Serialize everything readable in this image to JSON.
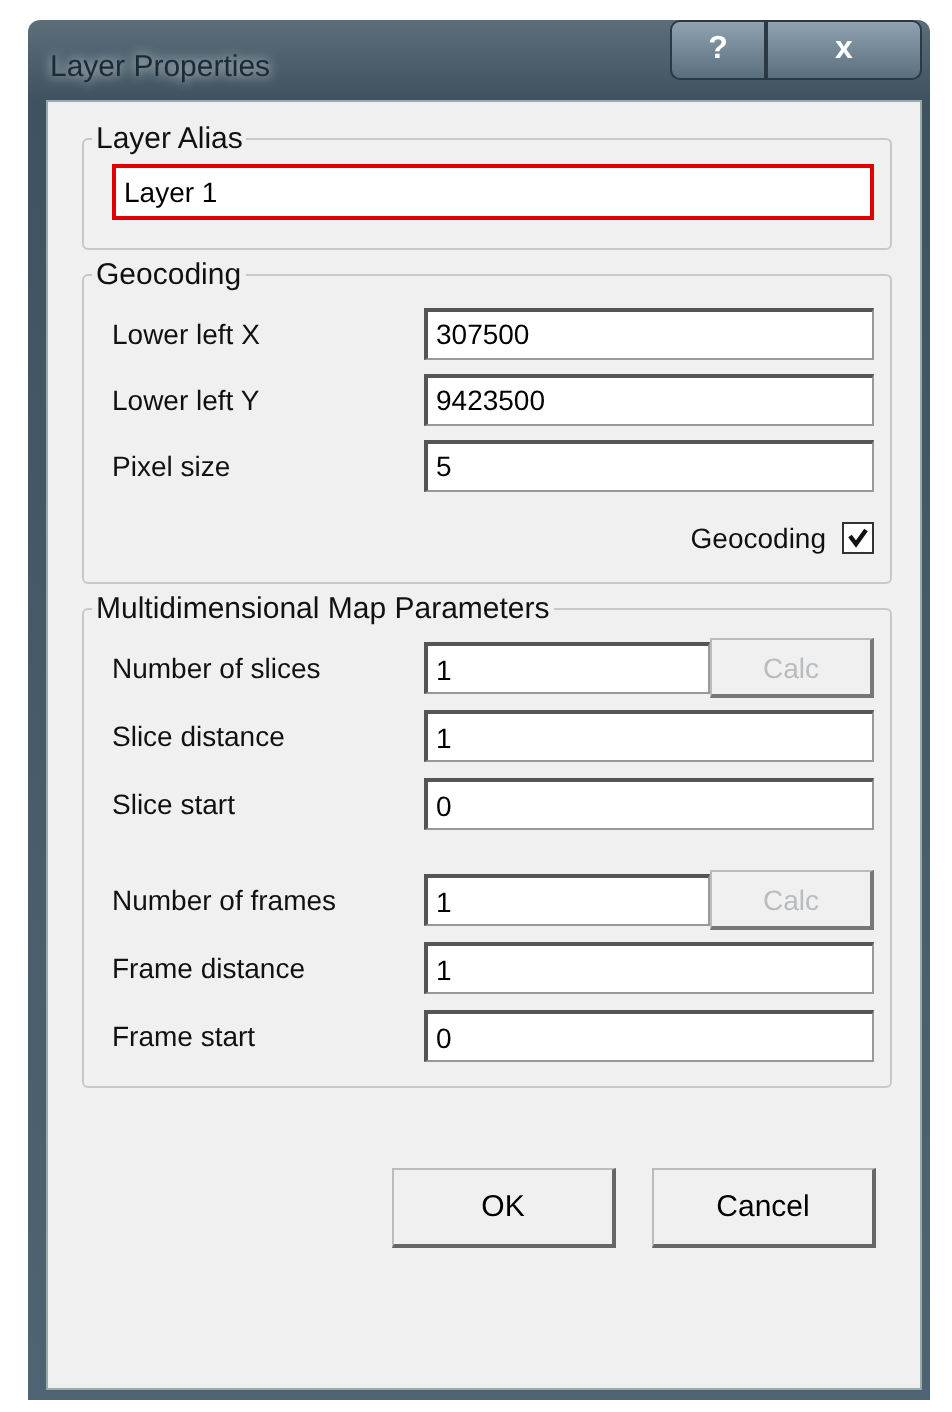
{
  "window": {
    "title": "Layer Properties",
    "title_buttons": [
      "?",
      "x"
    ]
  },
  "alias_group": {
    "title": "Layer Alias",
    "value": "Layer 1",
    "highlighted": true
  },
  "geocoding_group": {
    "title": "Geocoding",
    "rows": [
      {
        "label": "Lower left X",
        "value": "307500"
      },
      {
        "label": "Lower left Y",
        "value": "9423500"
      },
      {
        "label": "Pixel size",
        "value": "5"
      }
    ],
    "checkbox": {
      "label": "Geocoding",
      "checked": true
    }
  },
  "multi_group": {
    "title": "Multidimensional Map Parameters",
    "rows": [
      {
        "kind": "count",
        "label": "Number of slices",
        "value": "1",
        "button": {
          "label": "Calc",
          "disabled": true
        }
      },
      {
        "kind": "plain",
        "label": "Slice distance",
        "value": "1"
      },
      {
        "kind": "plain",
        "label": "Slice start",
        "value": "0"
      },
      {
        "kind": "count",
        "label": "Number of frames",
        "value": "1",
        "button": {
          "label": "Calc",
          "disabled": true
        }
      },
      {
        "kind": "plain",
        "label": "Frame distance",
        "value": "1"
      },
      {
        "kind": "plain",
        "label": "Frame start",
        "value": "0"
      }
    ]
  },
  "buttons": [
    "OK",
    "Cancel"
  ]
}
